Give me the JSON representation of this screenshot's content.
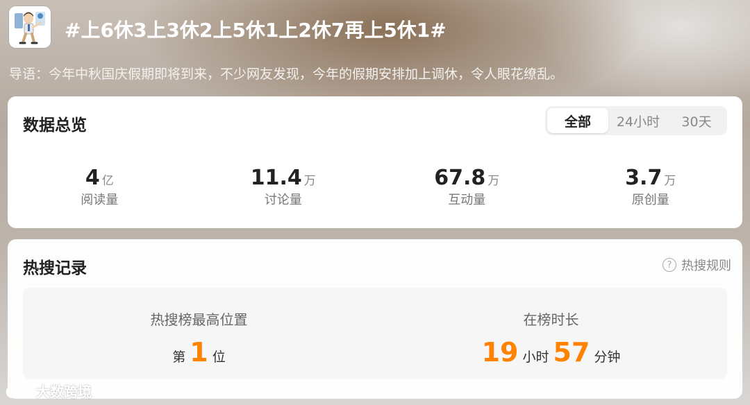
{
  "topic": {
    "title": "#上6休3上3休2上5休1上2休7再上5休1#",
    "avatar_icon": "cartoon-person-avatar",
    "intro": "导语：今年中秋国庆假期即将到来，不少网友发现，今年的假期安排加上调休，令人眼花缭乱。"
  },
  "overview": {
    "title": "数据总览",
    "tabs": [
      {
        "label": "全部",
        "active": true
      },
      {
        "label": "24小时",
        "active": false
      },
      {
        "label": "30天",
        "active": false
      }
    ],
    "stats": [
      {
        "value": "4",
        "unit": "亿",
        "label": "阅读量"
      },
      {
        "value": "11.4",
        "unit": "万",
        "label": "讨论量"
      },
      {
        "value": "67.8",
        "unit": "万",
        "label": "互动量"
      },
      {
        "value": "3.7",
        "unit": "万",
        "label": "原创量"
      }
    ]
  },
  "hot": {
    "title": "热搜记录",
    "rules_label": "热搜规则",
    "help_icon": "question-circle-icon",
    "peak": {
      "label": "热搜榜最高位置",
      "prefix": "第",
      "value": "1",
      "suffix": "位"
    },
    "duration": {
      "label": "在榜时长",
      "hours": "19",
      "hours_unit": "小时",
      "minutes": "57",
      "minutes_unit": "分钟"
    }
  },
  "watermark": {
    "text": "大数跨境",
    "logo_icon": "brand-logo-icon"
  },
  "colors": {
    "accent": "#ff8200",
    "text_primary": "#222222",
    "text_secondary": "#888888"
  }
}
